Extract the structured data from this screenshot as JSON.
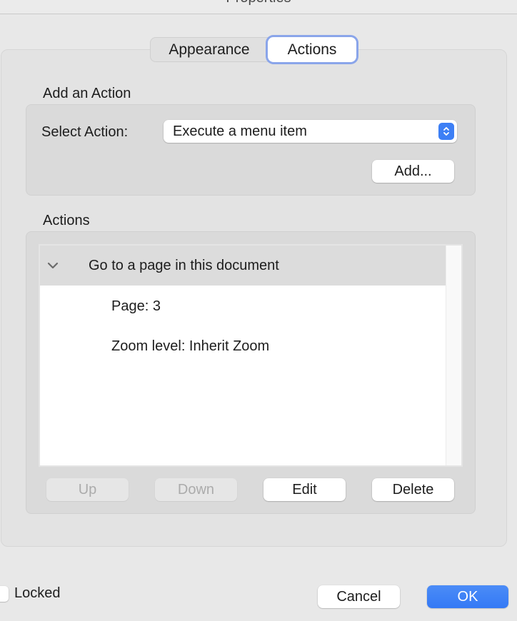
{
  "window": {
    "title": "Properties"
  },
  "tabs": [
    {
      "label": "Appearance",
      "selected": false
    },
    {
      "label": "Actions",
      "selected": true
    }
  ],
  "add_action": {
    "section_label": "Add an Action",
    "select_label": "Select Action:",
    "select_value": "Execute a menu item",
    "add_button": "Add..."
  },
  "actions": {
    "section_label": "Actions",
    "items": [
      {
        "title": "Go to a page in this document",
        "expanded": true,
        "details": [
          "Page: 3",
          "Zoom level: Inherit Zoom"
        ]
      }
    ],
    "buttons": {
      "up": {
        "label": "Up",
        "enabled": false
      },
      "down": {
        "label": "Down",
        "enabled": false
      },
      "edit": {
        "label": "Edit",
        "enabled": true
      },
      "delete": {
        "label": "Delete",
        "enabled": true
      }
    }
  },
  "footer": {
    "locked_label": "Locked",
    "locked_checked": false,
    "cancel_button": "Cancel",
    "ok_button": "OK"
  },
  "colors": {
    "accent": "#3d7ff5",
    "focus_ring": "#8aa5ea"
  }
}
